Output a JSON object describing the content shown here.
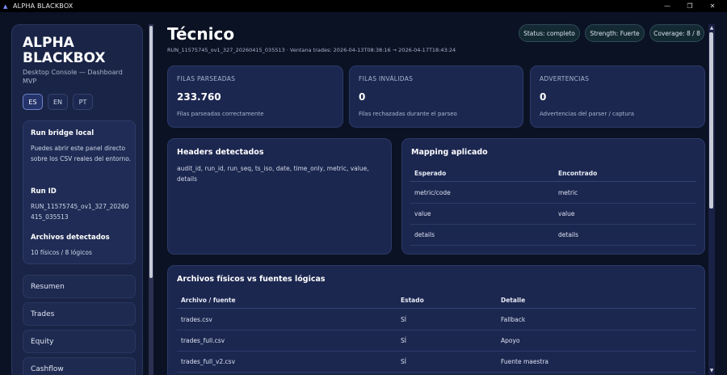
{
  "window": {
    "title": "ALPHA BLACKBOX"
  },
  "sidebar": {
    "brand": "ALPHA BLACKBOX",
    "subtitle": "Desktop Console — Dashboard MVP",
    "languages": [
      "ES",
      "EN",
      "PT"
    ],
    "active_language": "ES",
    "bridge_title": "Run bridge local",
    "bridge_text": "Puedes abrir este panel directo sobre los CSV reales del entorno.",
    "run_id_label": "Run ID",
    "run_id_value": "RUN_11575745_ov1_327_20260415_035513",
    "files_label": "Archivos detectados",
    "files_value": "10 físicos / 8 lógicos",
    "nav": [
      "Resumen",
      "Trades",
      "Equity",
      "Cashflow"
    ]
  },
  "header": {
    "title": "Técnico",
    "run_line": "RUN_11575745_ov1_327_20260415_035513 · Ventana trades: 2026-04-13T08:38:16 → 2026-04-17T18:43:24",
    "badges": [
      "Status: completo",
      "Strength: Fuerte",
      "Coverage: 8 / 8"
    ]
  },
  "stats": [
    {
      "label": "FILAS PARSEADAS",
      "value": "233.760",
      "desc": "Filas parseadas correctamente"
    },
    {
      "label": "FILAS INVÁLIDAS",
      "value": "0",
      "desc": "Filas rechazadas durante el parseo"
    },
    {
      "label": "ADVERTENCIAS",
      "value": "0",
      "desc": "Advertencias del parser / captura"
    }
  ],
  "headers_card": {
    "title": "Headers detectados",
    "text": "audit_id, run_id, run_seq, ts_iso, date, time_only, metric, value, details"
  },
  "mapping_card": {
    "title": "Mapping aplicado",
    "columns": [
      "Esperado",
      "Encontrado"
    ],
    "rows": [
      [
        "metric/code",
        "metric"
      ],
      [
        "value",
        "value"
      ],
      [
        "details",
        "details"
      ]
    ]
  },
  "files_card": {
    "title": "Archivos físicos vs fuentes lógicas",
    "columns": [
      "Archivo / fuente",
      "Estado",
      "Detalle"
    ],
    "rows": [
      [
        "trades.csv",
        "SÍ",
        "Fallback"
      ],
      [
        "trades_full.csv",
        "SÍ",
        "Apoyo"
      ],
      [
        "trades_full_v2.csv",
        "SÍ",
        "Fuente maestra"
      ]
    ]
  }
}
